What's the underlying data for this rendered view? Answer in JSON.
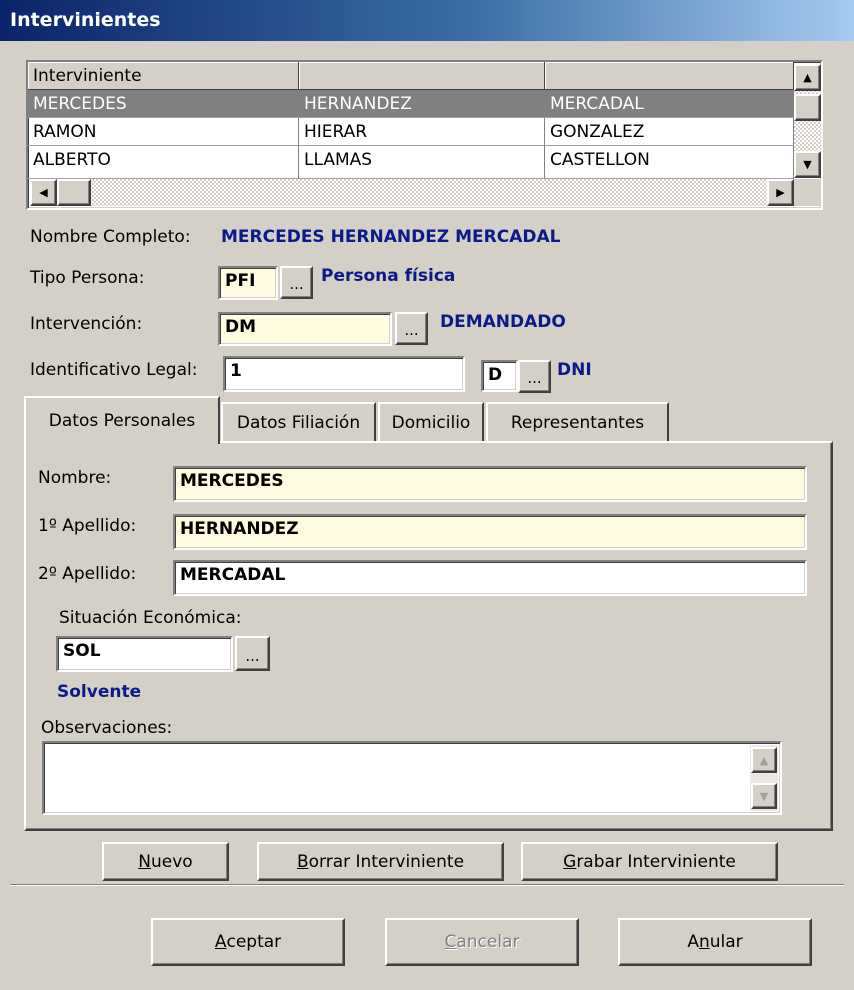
{
  "window": {
    "title": "Intervinientes"
  },
  "grid": {
    "headers": [
      "Interviniente",
      "",
      ""
    ],
    "rows": [
      [
        "MERCEDES",
        "HERNANDEZ",
        "MERCADAL"
      ],
      [
        "RAMON",
        "HIERAR",
        "GONZALEZ"
      ],
      [
        "ALBERTO",
        "LLAMAS",
        "CASTELLON"
      ]
    ]
  },
  "summary": {
    "nombre_completo_label": "Nombre Completo:",
    "nombre_completo_value": "MERCEDES HERNANDEZ MERCADAL",
    "tipo_persona_label": "Tipo Persona:",
    "tipo_persona_code": "PFI",
    "tipo_persona_desc": "Persona física",
    "intervencion_label": "Intervención:",
    "intervencion_code": "DM",
    "intervencion_desc": "DEMANDADO",
    "identificativo_label": "Identificativo Legal:",
    "identificativo_value": "1",
    "identificativo_type_code": "D",
    "identificativo_type_desc": "DNI",
    "ellipsis": "..."
  },
  "tabs": [
    "Datos Personales",
    "Datos Filiación",
    "Domicilio",
    "Representantes"
  ],
  "personal": {
    "nombre_label": "Nombre:",
    "nombre_value": "MERCEDES",
    "apellido1_label": "1º Apellido:",
    "apellido1_value": "HERNANDEZ",
    "apellido2_label": "2º Apellido:",
    "apellido2_value": "MERCADAL",
    "situacion_label": "Situación Económica:",
    "situacion_code": "SOL",
    "situacion_desc": "Solvente",
    "observaciones_label": "Observaciones:",
    "observaciones_value": ""
  },
  "actions": {
    "nuevo_u": "N",
    "nuevo_rest": "uevo",
    "borrar_u": "B",
    "borrar_rest": "orrar Interviniente",
    "grabar_u": "G",
    "grabar_rest": "rabar Interviniente"
  },
  "footer": {
    "aceptar_u": "A",
    "aceptar_rest": "ceptar",
    "cancelar_u": "C",
    "cancelar_rest": "ancelar",
    "anular_pre": "A",
    "anular_u": "n",
    "anular_rest": "ular"
  },
  "icons": [
    "arrow-up-icon",
    "arrow-down-icon",
    "arrow-left-icon",
    "arrow-right-icon"
  ],
  "colors": {
    "title_bar": "#0a246a",
    "highlight_text": "#0a1a8a",
    "required_field": "#fffbe1",
    "selected_row": "#808080"
  }
}
